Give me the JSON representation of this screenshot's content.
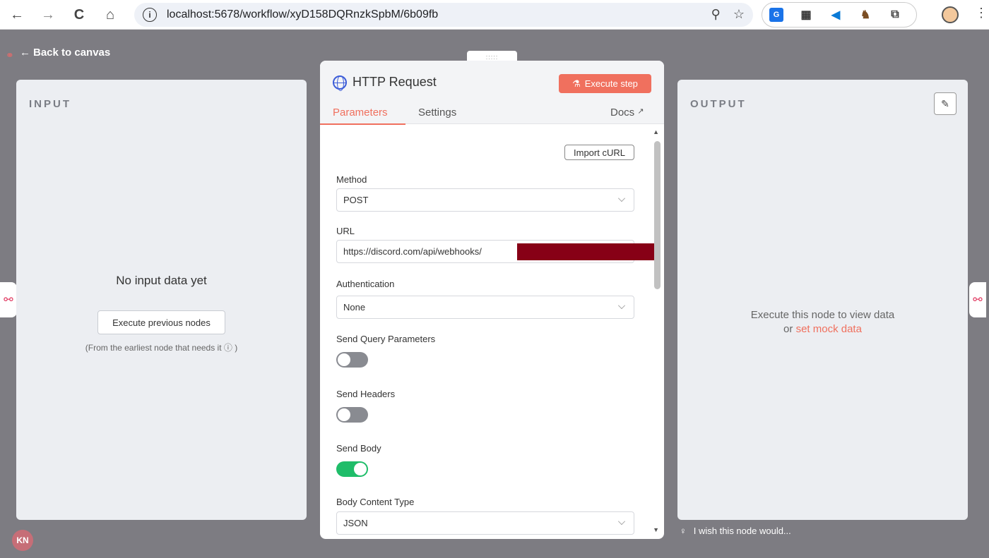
{
  "browser": {
    "url": "localhost:5678/workflow/xyD158DQRnzkSpbM/6b09fb",
    "nav": {
      "back_icon": "←",
      "forward_icon": "→",
      "reload_icon": "C",
      "home_icon": "⌂"
    },
    "info_icon": "i",
    "zoom_icon": "⚲",
    "star_icon": "☆",
    "menu_icon": "⋮",
    "extensions": [
      {
        "name": "translate",
        "text": "G",
        "bg": "#1a73e8",
        "fg": "#ffffff"
      },
      {
        "name": "qr",
        "text": "▦",
        "bg": "#ffffff",
        "fg": "#333333"
      },
      {
        "name": "vscode",
        "text": "◀",
        "bg": "#ffffff",
        "fg": "#0a7ad6"
      },
      {
        "name": "ext-animal",
        "text": "♞",
        "bg": "#ffffff",
        "fg": "#7a4d22"
      },
      {
        "name": "puzzle",
        "text": "⧉",
        "bg": "#ffffff",
        "fg": "#444444"
      }
    ]
  },
  "app": {
    "back_label": "Back to canvas",
    "back_icon": "←",
    "avatar_initials": "KN",
    "feedback_text": "I wish this node would...",
    "feedback_icon": "♀"
  },
  "input_panel": {
    "title": "INPUT",
    "empty_title": "No input data yet",
    "execute_prev_label": "Execute previous nodes",
    "hint": "(From the earliest node that needs it ⓘ )"
  },
  "output_panel": {
    "title": "OUTPUT",
    "edit_icon": "✎",
    "message_line1": "Execute this node to view data",
    "message_or": "or ",
    "mock_link": "set mock data"
  },
  "node": {
    "drag_handle": ":::::",
    "title": "HTTP Request",
    "execute_label": "Execute step",
    "execute_icon": "⚗",
    "tabs": {
      "parameters": "Parameters",
      "settings": "Settings",
      "docs": "Docs",
      "docs_icon": "↗"
    },
    "import_curl": "Import cURL",
    "fields": {
      "method_label": "Method",
      "method_value": "POST",
      "url_label": "URL",
      "url_value": "https://discord.com/api/webhooks/",
      "auth_label": "Authentication",
      "auth_value": "None",
      "query_label": "Send Query Parameters",
      "query_on": false,
      "headers_label": "Send Headers",
      "headers_on": false,
      "body_label": "Send Body",
      "body_on": true,
      "content_type_label": "Body Content Type",
      "content_type_value": "JSON"
    },
    "scroll_up": "▲",
    "scroll_down": "▼"
  },
  "colors": {
    "accent": "#f0705e",
    "toggle_on": "#1fbd69",
    "toggle_off": "#898b91",
    "redaction": "#870016"
  }
}
